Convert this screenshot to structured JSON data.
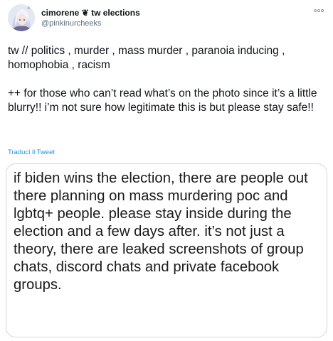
{
  "user": {
    "display_name": "cimorene ❦ tw elections",
    "handle": "@pinkinurcheeks",
    "avatar_icon": "anime-avatar-icon"
  },
  "tweet": {
    "paragraphs": [
      "tw // politics , murder , mass murder , paranoia inducing , homophobia , racism",
      "++ for those who can’t read what’s on the photo since it’s a little blurry!! i’m not sure how legitimate this is but please stay safe!!"
    ],
    "translate_label": "Traduci il Tweet"
  },
  "media": {
    "text": "if biden wins the election, there are people out there planning on mass murdering poc and lgbtq+ people. please stay inside during the election and a few days after. it’s not just a theory, there are leaked screenshots of group chats, discord chats and private facebook groups."
  },
  "colors": {
    "link": "#1b95e0",
    "secondary_text": "#5b7083",
    "border": "#cfd9de"
  }
}
